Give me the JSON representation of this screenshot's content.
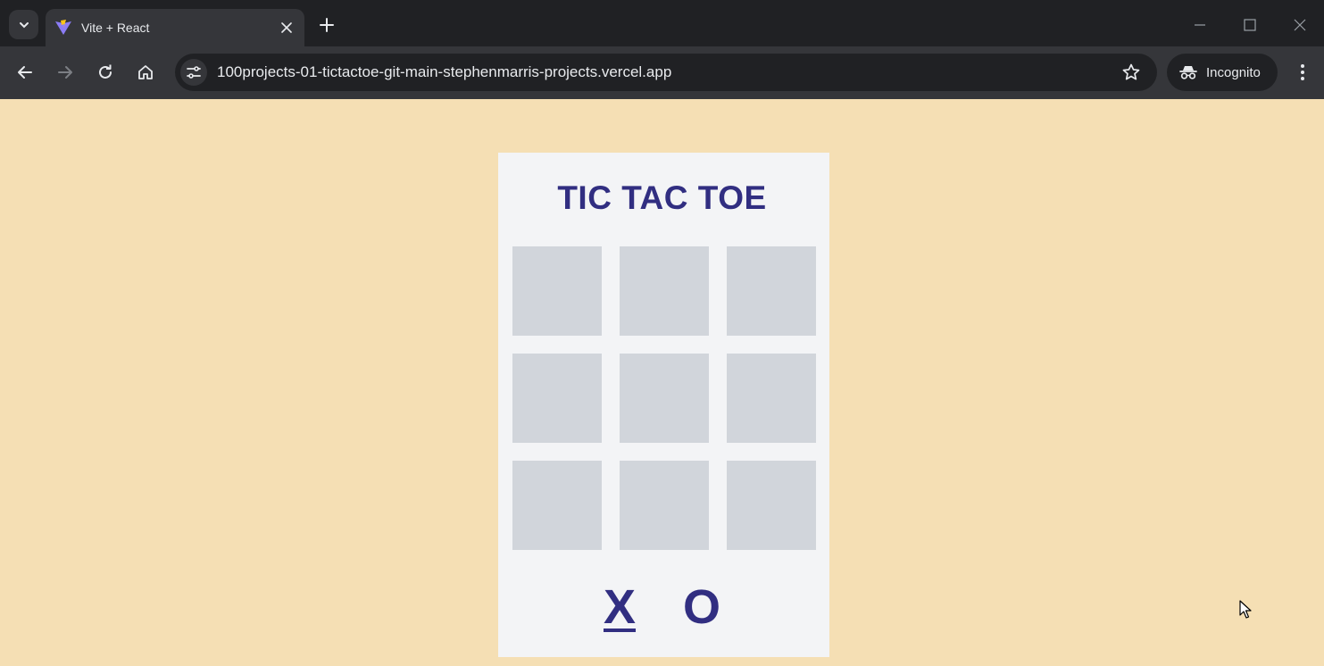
{
  "browser": {
    "tab": {
      "title": "Vite + React",
      "favicon": "vite-logo"
    },
    "url": "100projects-01-tictactoe-git-main-stephenmarris-projects.vercel.app",
    "incognito_label": "Incognito"
  },
  "game": {
    "title": "TIC TAC TOE",
    "board": [
      "",
      "",
      "",
      "",
      "",
      "",
      "",
      "",
      ""
    ],
    "players": {
      "x": "X",
      "o": "O"
    },
    "active_player": "X"
  },
  "colors": {
    "page_bg": "#f5dfb4",
    "card_bg": "#f3f4f6",
    "cell_bg": "#d1d5db",
    "accent": "#312e81"
  }
}
